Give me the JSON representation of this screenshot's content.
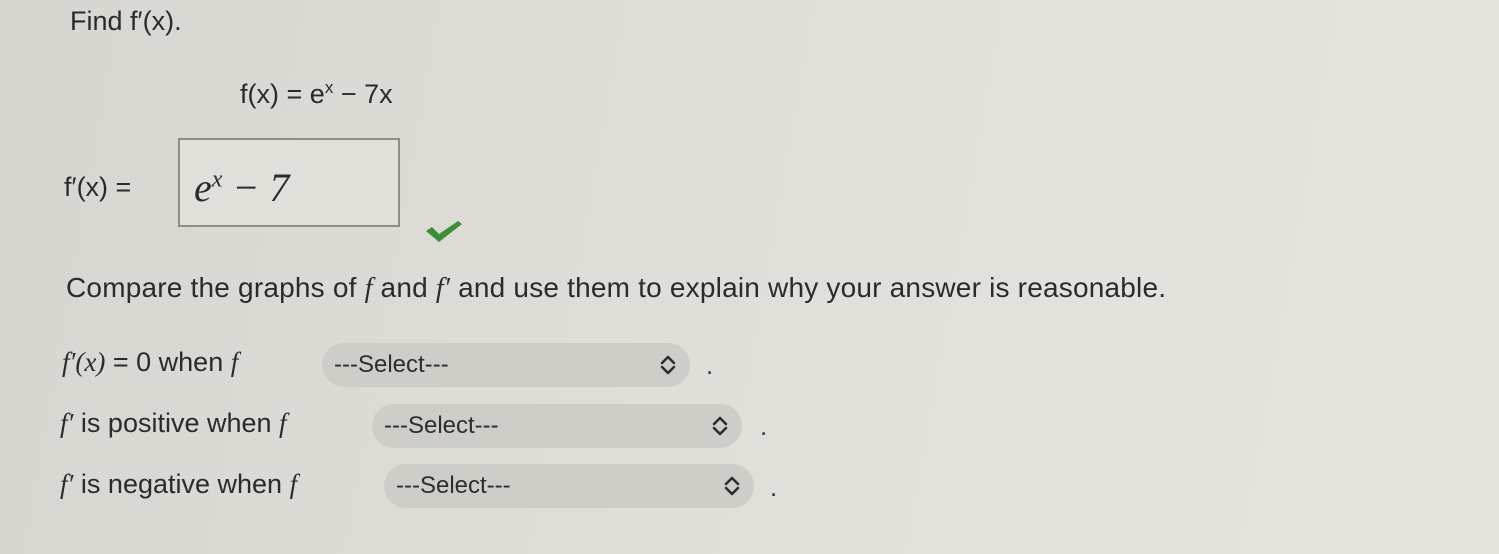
{
  "prompt": {
    "title": "Find f′(x).",
    "function_lhs": "f(x)",
    "function_equals": "=",
    "function_base": "e",
    "function_exp": "x",
    "function_tail": "− 7x"
  },
  "answer": {
    "label": "f′(x) =",
    "base": "e",
    "exp": "x",
    "tail": " − 7",
    "status": "correct"
  },
  "compare": {
    "text_before": "Compare the graphs of ",
    "f": "f",
    "text_and": " and ",
    "f_prime": "f′",
    "text_after": " and use them to explain why your answer is reasonable."
  },
  "rows": [
    {
      "label_math": "f′(x)",
      "label_text": " = 0 when ",
      "label_f": "f",
      "select_value": "---Select---",
      "punct": "."
    },
    {
      "label_math": "f′",
      "label_text": " is positive when ",
      "label_f": "f",
      "select_value": "---Select---",
      "punct": "."
    },
    {
      "label_math": "f′",
      "label_text": " is negative when ",
      "label_f": "f",
      "select_value": "---Select---",
      "punct": "."
    }
  ],
  "colors": {
    "check": "#3a8f3a",
    "select_bg": "#cfcdc8"
  },
  "icons": {
    "check": "checkmark-icon",
    "select": "up-down-chevron-icon"
  }
}
